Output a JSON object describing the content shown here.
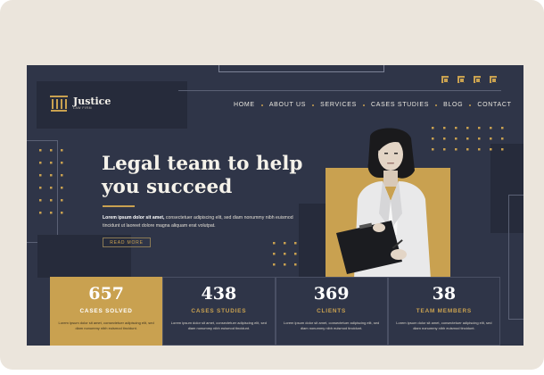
{
  "brand": {
    "name": "Justice",
    "tagline": "LAW FIRM"
  },
  "social": [
    {
      "icon": "facebook-icon"
    },
    {
      "icon": "instagram-icon"
    },
    {
      "icon": "youtube-icon"
    },
    {
      "icon": "linkedin-icon"
    }
  ],
  "nav": {
    "items": [
      {
        "label": "HOME"
      },
      {
        "label": "ABOUT US"
      },
      {
        "label": "SERVICES"
      },
      {
        "label": "CASES STUDIES"
      },
      {
        "label": "BLOG"
      },
      {
        "label": "CONTACT"
      }
    ]
  },
  "hero": {
    "title_line1": "Legal team to help",
    "title_line2": "you succeed",
    "body_bold": "Lorem ipsum dolor sit amet,",
    "body_rest": " consectetuer adipiscing elit, sed diam nonummy nibh euismod tincidunt ut laoreet dolore magna aliquam erat volutpat.",
    "cta": "READ MORE"
  },
  "stats": [
    {
      "value": "657",
      "label": "CASES SOLVED",
      "text": "Lorem ipsum dolor sit amet, consectetuer adipiscing elit, sed diam nonummy nibh euismod tincidunt."
    },
    {
      "value": "438",
      "label": "CASES STUDIES",
      "text": "Lorem ipsum dolor sit amet, consectetuer adipiscing elit, sed diam nonummy nibh euismod tincidunt."
    },
    {
      "value": "369",
      "label": "CLIENTS",
      "text": "Lorem ipsum dolor sit amet, consectetuer adipiscing elit, sed diam nonummy nibh euismod tincidunt."
    },
    {
      "value": "38",
      "label": "TEAM MEMBERS",
      "text": "Lorem ipsum dolor sit amet, consectetuer adipiscing elit, sed diam nonummy nibh euismod tincidunt."
    }
  ],
  "colors": {
    "navy": "#2f3548",
    "gold": "#c9a150",
    "background": "#ebe5dc"
  }
}
